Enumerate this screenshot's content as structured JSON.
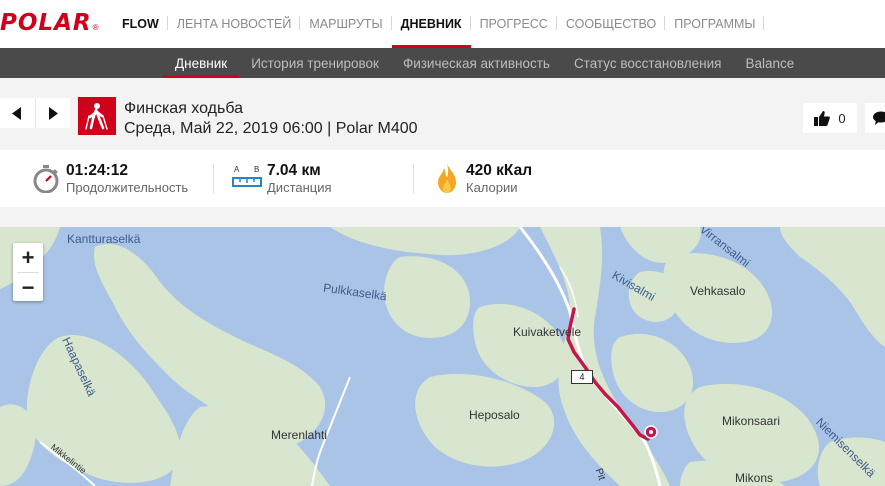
{
  "colors": {
    "brand": "#d0021b",
    "subnav_bg": "#4a4a4a",
    "water": "#a9c4e6",
    "land": "#d8e6cf",
    "route": "#c2184b"
  },
  "topnav": {
    "logo": "POLAR",
    "logo_reg": "®",
    "items": [
      {
        "label": "FLOW"
      },
      {
        "label": "ЛЕНТА НОВОСТЕЙ"
      },
      {
        "label": "МАРШРУТЫ"
      },
      {
        "label": "ДНЕВНИК",
        "active": true
      },
      {
        "label": "ПРОГРЕСС"
      },
      {
        "label": "СООБЩЕСТВО"
      },
      {
        "label": "ПРОГРАММЫ"
      }
    ]
  },
  "subnav": {
    "items": [
      {
        "label": "Дневник",
        "active": true
      },
      {
        "label": "История тренировок"
      },
      {
        "label": "Физическая активность"
      },
      {
        "label": "Статус восстановления"
      },
      {
        "label": "Balance"
      }
    ]
  },
  "session": {
    "sport_icon": "walking-person-icon",
    "title": "Финская ходьба",
    "subtitle": "Среда, Май 22, 2019 06:00 | Polar M400",
    "likes": "0"
  },
  "stats": {
    "duration": {
      "value": "01:24:12",
      "label": "Продолжительность",
      "icon": "stopwatch-icon"
    },
    "distance": {
      "value": "7.04 км",
      "label": "Дистанция",
      "icon": "distance-ruler-icon",
      "a": "A",
      "b": "B"
    },
    "calories": {
      "value": "420 кКал",
      "label": "Калории",
      "icon": "flame-icon"
    }
  },
  "map": {
    "zoom_in": "+",
    "zoom_out": "−",
    "road_number": "4",
    "labels": [
      {
        "text": "Kantturaselkä",
        "type": "water"
      },
      {
        "text": "Pulkkaselkä",
        "type": "water"
      },
      {
        "text": "Haapaselkä",
        "type": "water"
      },
      {
        "text": "Kivisalmi",
        "type": "water"
      },
      {
        "text": "Virransalmi",
        "type": "water"
      },
      {
        "text": "Vehkasalo",
        "type": "land"
      },
      {
        "text": "Kuivaketvele",
        "type": "land"
      },
      {
        "text": "Heposalo",
        "type": "land"
      },
      {
        "text": "Merenlahti",
        "type": "land"
      },
      {
        "text": "Mikonsaari",
        "type": "land"
      },
      {
        "text": "Mikons",
        "type": "land"
      },
      {
        "text": "Niemisenselkä",
        "type": "water"
      },
      {
        "text": "Mikkelintie",
        "type": "land"
      },
      {
        "text": "Pit",
        "type": "land"
      }
    ]
  }
}
